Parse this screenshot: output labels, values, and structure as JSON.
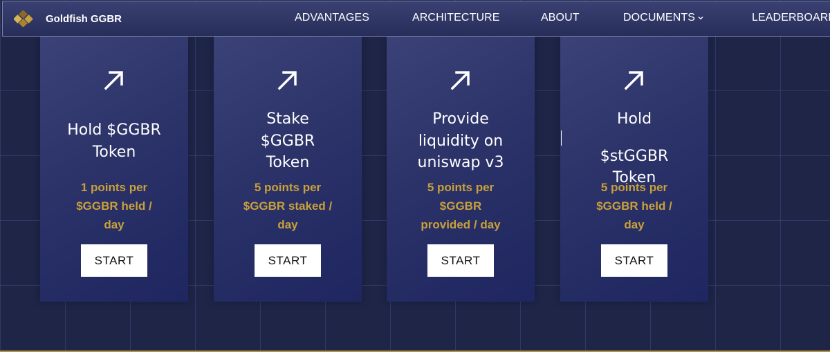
{
  "nav": {
    "brand": "Goldfish GGBR",
    "links": [
      "ADVANTAGES",
      "ARCHITECTURE",
      "ABOUT",
      "DOCUMENTS",
      "LEADERBOARD"
    ]
  },
  "colors": {
    "background": "#1e2547",
    "card": "#2b3369",
    "accent_gold": "#c9a03a",
    "button_bg": "#ffffff"
  },
  "cards": [
    {
      "icon": "arrow-up-right-icon",
      "title_lines": [
        "Hold $GGBR",
        "Token"
      ],
      "points_lines": [
        "1 points per",
        "$GGBR held /",
        "day"
      ],
      "button": "START"
    },
    {
      "icon": "arrow-up-right-icon",
      "title_lines": [
        "Stake",
        "$GGBR",
        "Token"
      ],
      "points_lines": [
        "5 points per",
        "$GGBR staked /",
        "day"
      ],
      "button": "START"
    },
    {
      "icon": "arrow-up-right-icon",
      "title_lines": [
        "Provide",
        "liquidity on",
        "uniswap v3"
      ],
      "points_lines": [
        "5 points per",
        "$GGBR",
        "provided / day"
      ],
      "button": "START"
    },
    {
      "icon": "arrow-up-right-icon",
      "title_lines": [
        "Hold",
        "$stGGBR",
        "Token"
      ],
      "points_lines": [
        "5 points per",
        "$GGBR held /",
        "day"
      ],
      "button": "START"
    }
  ]
}
